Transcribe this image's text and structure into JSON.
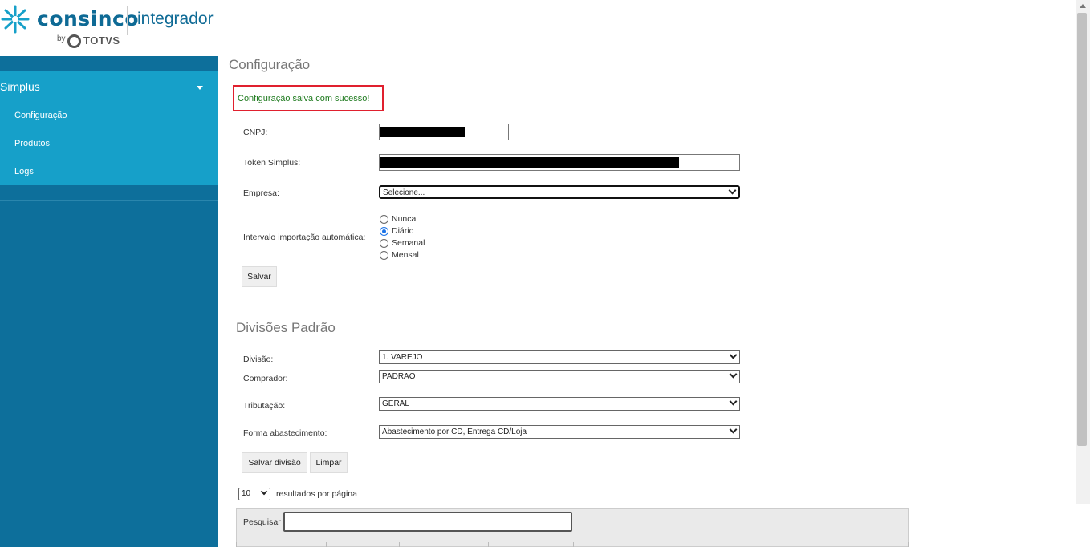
{
  "brand": {
    "name": "consinco",
    "by": "by",
    "partner": "TOTVS",
    "product": "integrador"
  },
  "sidebar": {
    "group_label": "Simplus",
    "items": [
      {
        "label": "Configuração"
      },
      {
        "label": "Produtos"
      },
      {
        "label": "Logs"
      }
    ]
  },
  "config": {
    "title": "Configuração",
    "success_message": "Configuração salva com sucesso!",
    "cnpj_label": "CNPJ:",
    "token_label": "Token Simplus:",
    "empresa_label": "Empresa:",
    "empresa_value": "Selecione...",
    "interval_label": "Intervalo importação automática:",
    "interval_options": [
      {
        "label": "Nunca",
        "checked": false
      },
      {
        "label": "Diário",
        "checked": true
      },
      {
        "label": "Semanal",
        "checked": false
      },
      {
        "label": "Mensal",
        "checked": false
      }
    ],
    "save_label": "Salvar"
  },
  "divisoes": {
    "title": "Divisões Padrão",
    "divisao_label": "Divisão:",
    "divisao_value": "1. VAREJO",
    "comprador_label": "Comprador:",
    "comprador_value": "PADRAO",
    "tributacao_label": "Tributação:",
    "tributacao_value": "GERAL",
    "forma_label": "Forma abastecimento:",
    "forma_value": "Abastecimento por CD, Entrega CD/Loja",
    "save_label": "Salvar divisão",
    "clear_label": "Limpar"
  },
  "table": {
    "page_size": "10",
    "page_size_suffix": "resultados por página",
    "search_label": "Pesquisar",
    "search_value": ""
  }
}
